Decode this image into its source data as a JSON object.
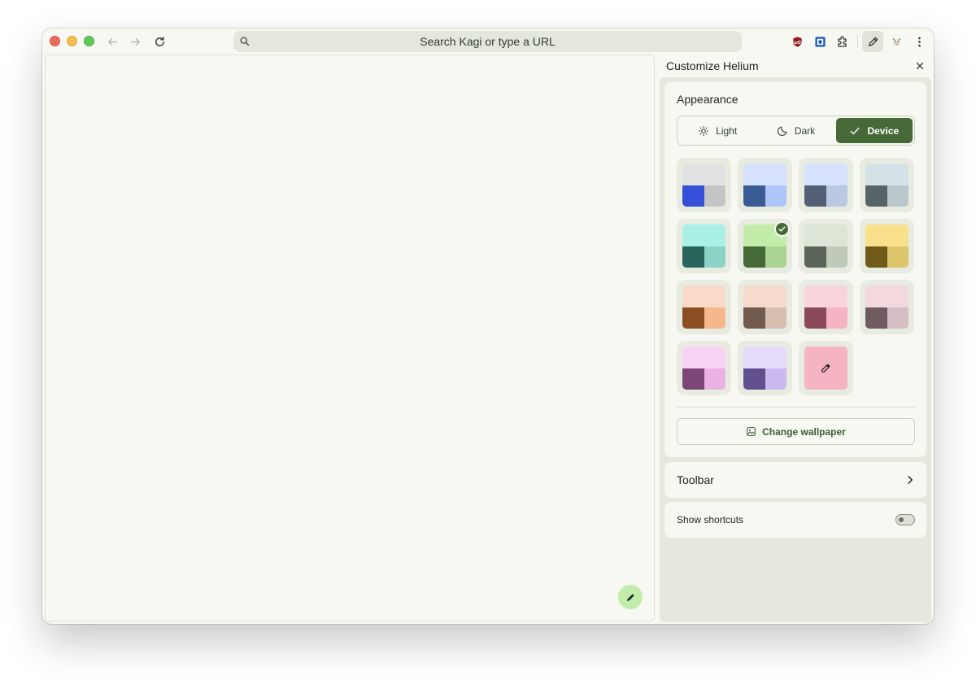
{
  "window": {
    "traffic_lights": [
      "close",
      "minimize",
      "maximize"
    ],
    "nav": {
      "back_icon": "arrow-left-icon",
      "forward_icon": "arrow-right-icon",
      "reload_icon": "reload-icon"
    }
  },
  "omnibox": {
    "placeholder": "Search Kagi or type a URL",
    "icon": "search-icon"
  },
  "extensions": [
    {
      "name": "ublock-origin",
      "icon": "ublock-icon"
    },
    {
      "name": "bitwarden",
      "icon": "shield-extension-icon"
    },
    {
      "name": "extensions",
      "icon": "puzzle-icon"
    },
    {
      "name": "customize",
      "icon": "pencil-icon",
      "active": true
    },
    {
      "name": "profile",
      "icon": "avatar-icon"
    },
    {
      "name": "menu",
      "icon": "more-vertical-icon"
    }
  ],
  "panel": {
    "title": "Customize Helium",
    "appearance": {
      "title": "Appearance",
      "modes": [
        {
          "label": "Light",
          "icon": "sun-icon",
          "selected": false
        },
        {
          "label": "Dark",
          "icon": "moon-icon",
          "selected": false
        },
        {
          "label": "Device",
          "icon": "check-icon",
          "selected": true
        }
      ],
      "swatches": [
        {
          "top": "#e2e2e2",
          "bl": "#3450d6",
          "br": "#c5c5c5",
          "selected": false
        },
        {
          "top": "#d6e2fb",
          "bl": "#3a5c95",
          "br": "#afc5f9",
          "selected": false
        },
        {
          "top": "#d6e2fb",
          "bl": "#545f75",
          "br": "#bac8e2",
          "selected": false
        },
        {
          "top": "#d4e1e6",
          "bl": "#576467",
          "br": "#bac8cd",
          "selected": false
        },
        {
          "top": "#aaf0e6",
          "bl": "#26645c",
          "br": "#8cd2c5",
          "selected": false
        },
        {
          "top": "#c3ecaa",
          "bl": "#466a37",
          "br": "#a9d493",
          "selected": true
        },
        {
          "top": "#dce5d6",
          "bl": "#5a6458",
          "br": "#bfcbb8",
          "selected": false
        },
        {
          "top": "#f9e18c",
          "bl": "#6f5a18",
          "br": "#ddc56c",
          "selected": false
        },
        {
          "top": "#f9dac8",
          "bl": "#8a4e22",
          "br": "#f5b88c",
          "selected": false
        },
        {
          "top": "#f6dbcc",
          "bl": "#735b4f",
          "br": "#d8bdb1",
          "selected": false
        },
        {
          "top": "#f9d5db",
          "bl": "#8b4a5a",
          "br": "#f5b4c2",
          "selected": false
        },
        {
          "top": "#f3d9de",
          "bl": "#705b60",
          "br": "#d6bfc4",
          "selected": false
        },
        {
          "top": "#f6d3f2",
          "bl": "#7c4678",
          "br": "#e9b2e3",
          "selected": false
        },
        {
          "top": "#e6dafa",
          "bl": "#62508e",
          "br": "#cbbaf0",
          "selected": false
        }
      ],
      "custom_swatch": {
        "color": "#f5b4c2",
        "icon": "eyedropper-icon"
      },
      "wallpaper_button": {
        "label": "Change wallpaper",
        "icon": "image-icon"
      }
    },
    "toolbar": {
      "label": "Toolbar",
      "icon": "chevron-right-icon"
    },
    "shortcuts": {
      "label": "Show shortcuts",
      "enabled": false
    }
  },
  "fab": {
    "icon": "pencil-icon"
  },
  "colors": {
    "accent": "#466a37",
    "background": "#f7f8f1",
    "panel_background": "#e5e9dd",
    "fab": "#c1ecaa"
  }
}
